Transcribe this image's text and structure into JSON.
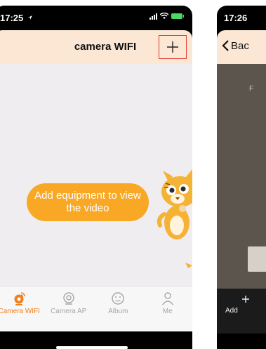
{
  "left_screen": {
    "status": {
      "time": "17:25"
    },
    "nav": {
      "title": "camera WIFI",
      "add_button_icon": "plus-icon"
    },
    "content": {
      "prompt": "Add equipment to view the video"
    },
    "tabs": [
      {
        "label": "Camera WIFI",
        "icon": "camera-wifi-icon",
        "active": true
      },
      {
        "label": "Camera AP",
        "icon": "webcam-icon",
        "active": false
      },
      {
        "label": "Album",
        "icon": "album-icon",
        "active": false
      },
      {
        "label": "Me",
        "icon": "person-icon",
        "active": false
      }
    ],
    "colors": {
      "accent": "#f08020",
      "bubble": "#f9a826",
      "nav_bg": "#fbe7d4",
      "content_bg": "#efedf0",
      "highlight_box": "#e53935"
    }
  },
  "right_screen": {
    "status": {
      "time": "17:26"
    },
    "nav": {
      "back_label": "Bac",
      "back_icon": "chevron-left-icon"
    },
    "content": {
      "partial_text": "F"
    },
    "bottom": {
      "label": "Add"
    }
  }
}
